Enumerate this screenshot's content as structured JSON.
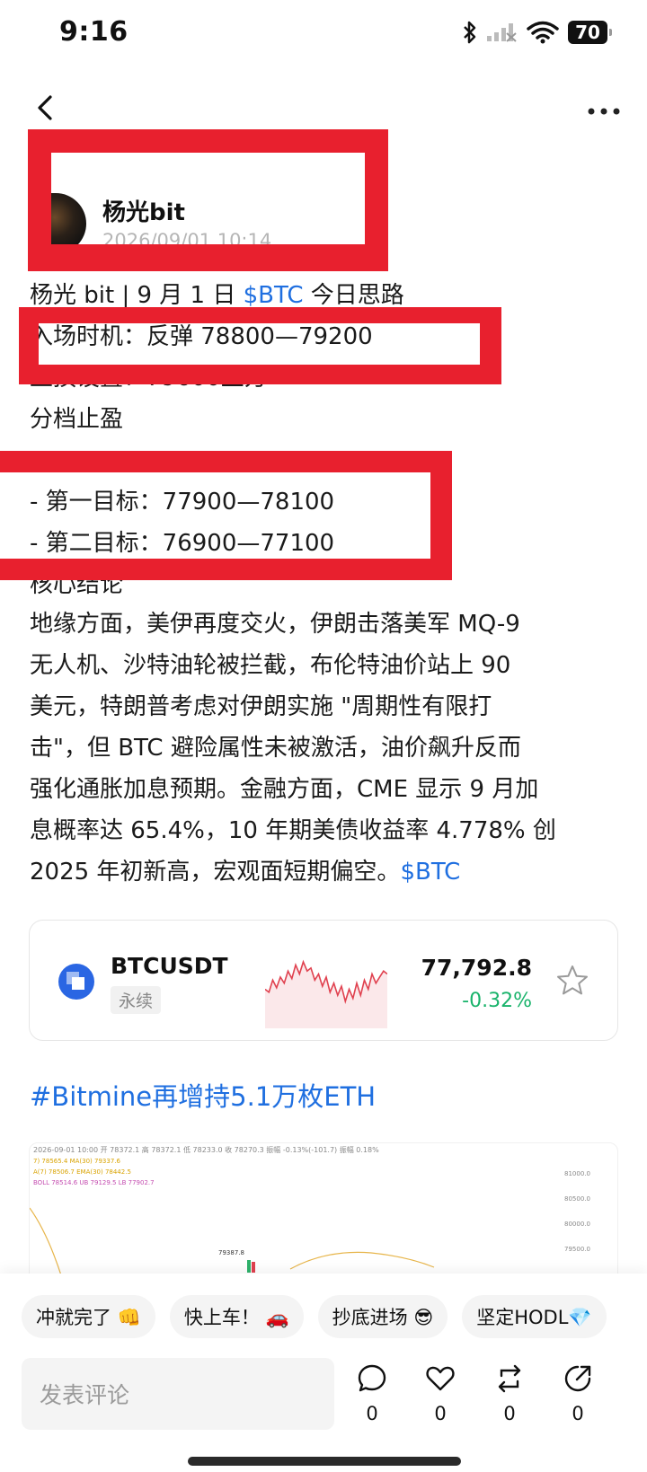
{
  "status_bar": {
    "time": "9:16",
    "battery": "70"
  },
  "author": {
    "name": "杨光bit",
    "timestamp": "2026/09/01 10:14"
  },
  "post": {
    "line1_prefix": "杨光 bit | 9 月 1 日 ",
    "line1_tag": "$BTC",
    "line1_suffix": " 今日思路",
    "entry": "入场时机：反弹 78800—79200",
    "stop_loss": "止损设置：79600上方",
    "take_profit": "分档止盈",
    "target1": "- 第一目标：77900—78100",
    "target2": "- 第二目标：76900—77100",
    "conclusion_title": "核心结论",
    "paragraph": [
      "地缘方面，美伊再度交火，伊朗击落美军 MQ-9",
      "无人机、沙特油轮被拦截，布伦特油价站上 90",
      "美元，特朗普考虑对伊朗实施 \"周期性有限打",
      "击\"，但 BTC 避险属性未被激活，油价飙升反而",
      "强化通胀加息预期。金融方面，CME 显示 9 月加",
      "息概率达 65.4%，10 年期美债收益率 4.778% 创"
    ],
    "last_line": "2025 年初新高，宏观面短期偏空。",
    "last_tag": "$BTC"
  },
  "ticker": {
    "symbol": "BTCUSDT",
    "contract_type": "永续",
    "price": "77,792.8",
    "change": "-0.32%",
    "sparkline": [
      54,
      52,
      60,
      55,
      62,
      58,
      66,
      61,
      70,
      64,
      72,
      66,
      68,
      60,
      64,
      56,
      62,
      52,
      58,
      50,
      56,
      46,
      54,
      48,
      58,
      50,
      60,
      54,
      64,
      58,
      62,
      66,
      64
    ],
    "colors": {
      "down": "#19b36b",
      "spark": "#e0414f"
    }
  },
  "hashtag": "#Bitmine再增持5.1万枚ETH",
  "chart_image": {
    "header": "2026-09-01 10:00  开 78372.1  高 78372.1  低 78233.0  收 78270.3  振幅 -0.13%(-101.7)  振幅 0.18%",
    "ma_line1": "7) 78565.4   MA(30) 79337.6",
    "ma_line2": "A(7) 78506.7   EMA(30) 78442.5",
    "ma_line3": "BOLL 78514.6   UB 79129.5   LB 77902.7",
    "price_labels": [
      "81000.0",
      "80500.0",
      "80000.0",
      "79500.0"
    ],
    "marker": "79387.8"
  },
  "reactions": [
    "冲就完了 👊",
    "快上车！ 🚗",
    "抄底进场 😎",
    "坚定HODL💎"
  ],
  "comment_placeholder": "发表评论",
  "actions": {
    "comment_count": "0",
    "like_count": "0",
    "repost_count": "0",
    "share_count": "0"
  }
}
